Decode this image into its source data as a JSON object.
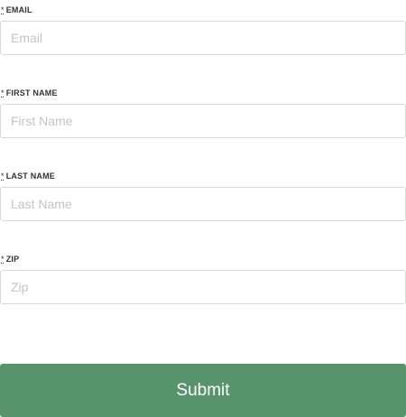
{
  "form": {
    "required_mark": "*",
    "fields": [
      {
        "label": "EMAIL",
        "placeholder": "Email",
        "value": ""
      },
      {
        "label": "FIRST NAME",
        "placeholder": "First Name",
        "value": ""
      },
      {
        "label": "LAST NAME",
        "placeholder": "Last Name",
        "value": ""
      },
      {
        "label": "ZIP",
        "placeholder": "Zip",
        "value": ""
      }
    ],
    "submit_label": "Submit"
  },
  "colors": {
    "submit_background": "#58946b",
    "input_border": "#d9d9d9",
    "label_text": "#333333",
    "placeholder_text": "#c4c4c4"
  }
}
